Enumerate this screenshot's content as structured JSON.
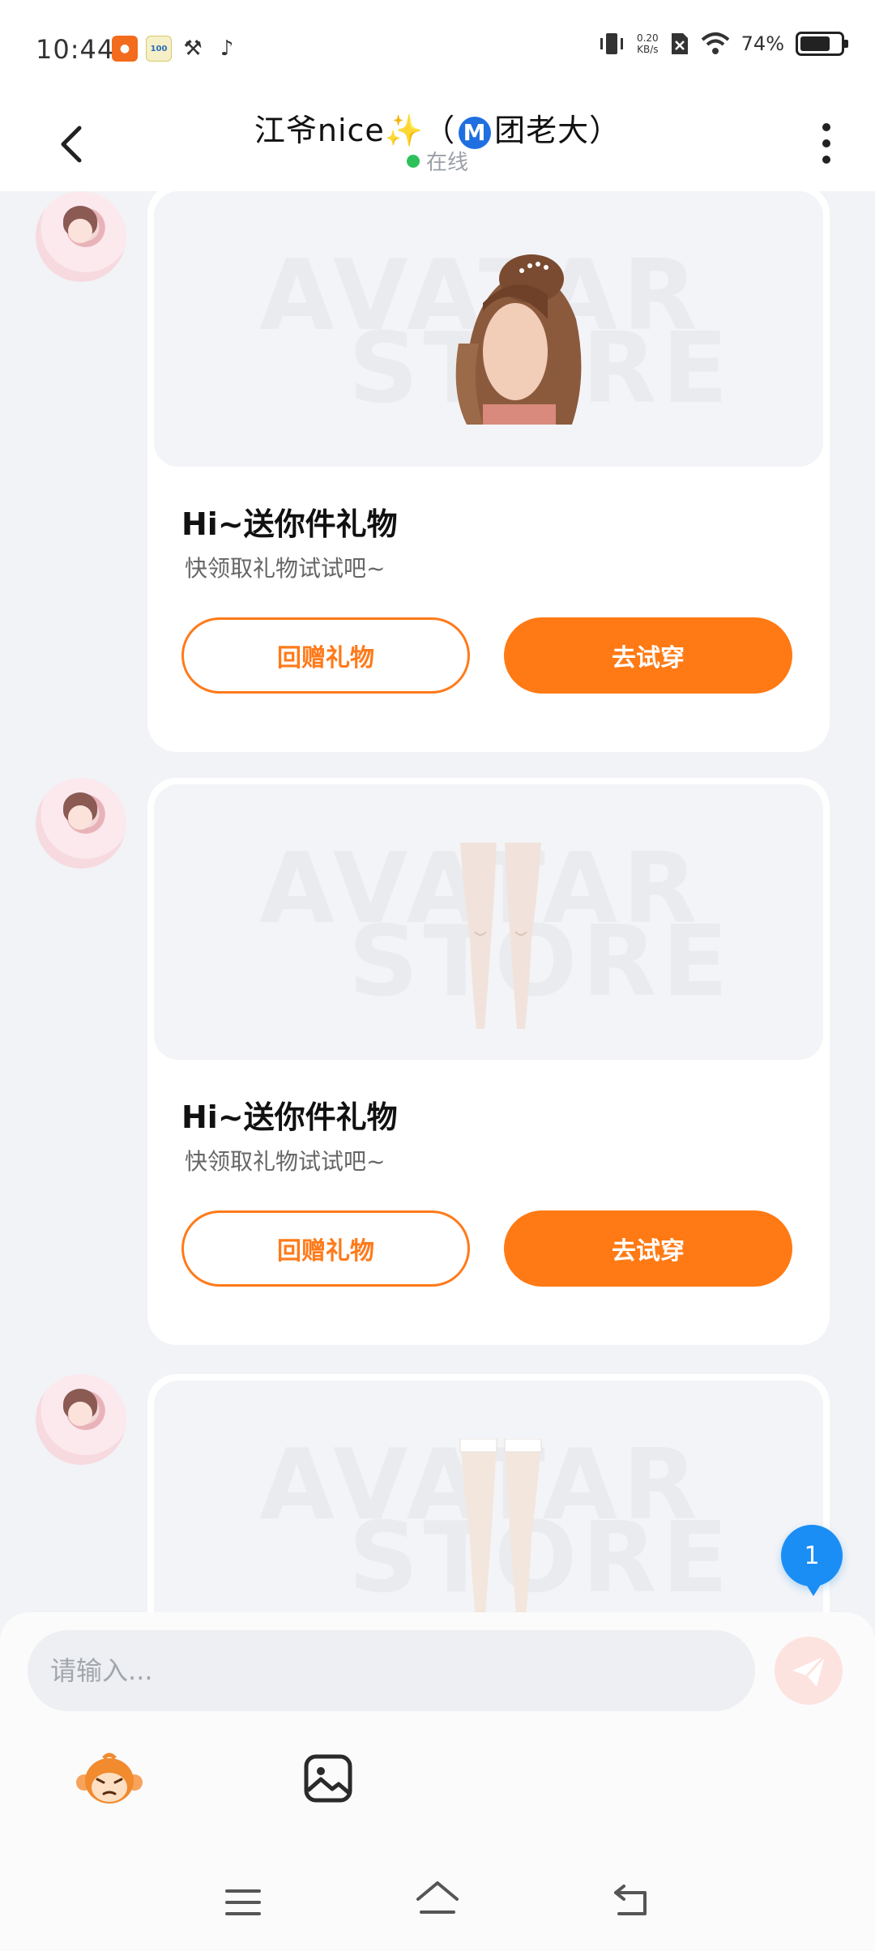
{
  "status_bar": {
    "time": "10:44",
    "app_icons": [
      "kuaishou-icon",
      "100-app-icon",
      "tools-icon",
      "tiktok-icon"
    ],
    "net_speed_value": "0.20",
    "net_speed_unit": "KB/s",
    "battery_percent": "74%",
    "battery_level": 0.74
  },
  "header": {
    "title_prefix": "江爷nice✨（",
    "badge_letter": "M",
    "title_suffix": "团老大）",
    "status": "在线"
  },
  "messages": [
    {
      "item": "hair",
      "title": "Hi~送你件礼物",
      "subtitle": "快领取礼物试试吧~",
      "return_label": "回赠礼物",
      "try_label": "去试穿"
    },
    {
      "item": "stockings",
      "title": "Hi~送你件礼物",
      "subtitle": "快领取礼物试试吧~",
      "return_label": "回赠礼物",
      "try_label": "去试穿"
    },
    {
      "item": "thigh-highs"
    }
  ],
  "watermark": {
    "line1": "AVATAR",
    "line2": "STORE"
  },
  "unread_count": "1",
  "input": {
    "placeholder": "请输入...",
    "value": ""
  },
  "colors": {
    "accent": "#ff7a14",
    "badge_blue": "#1f6fe0",
    "online": "#2ec05a",
    "unread": "#1a8ef5"
  }
}
